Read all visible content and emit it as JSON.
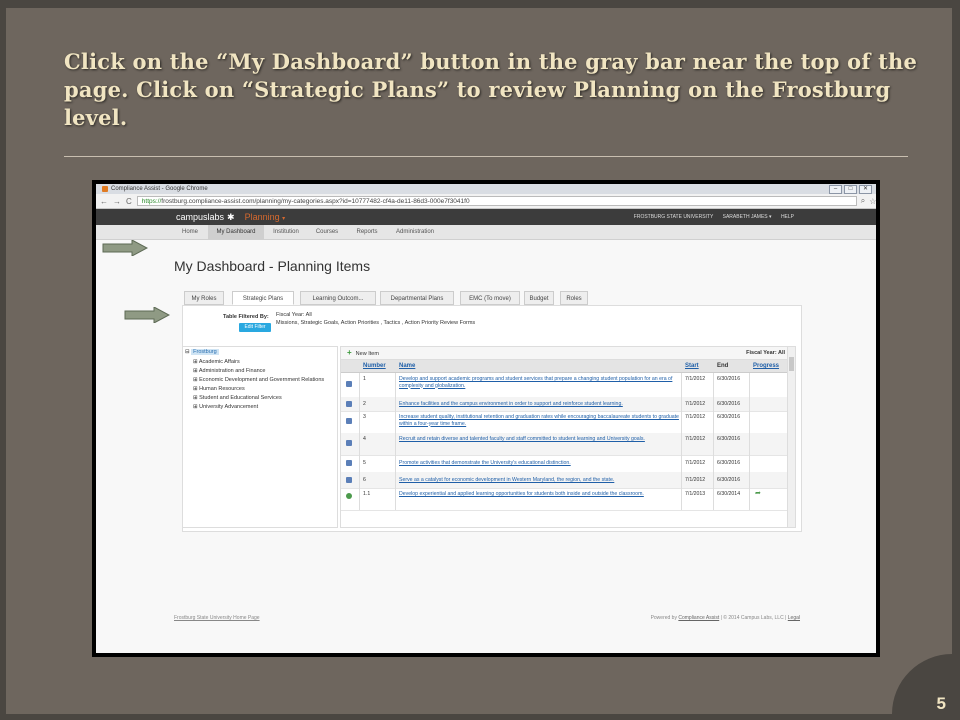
{
  "slide": {
    "title": "Click on the “My Dashboard” button in the gray bar near the top of the page. Click on “Strategic Plans” to review Planning on the Frostburg level.",
    "number": "5"
  },
  "browser": {
    "window_title": "Compliance Assist - Google Chrome",
    "url_scheme": "https://",
    "url_rest": "frostburg.compliance-assist.com/planning/my-categories.aspx?id=10777482-cf4a-de11-86d3-000e7f3041f0"
  },
  "topnav": {
    "logo": "campuslabs",
    "product": "Planning",
    "product_caret": "▾",
    "university": "FROSTBURG STATE UNIVERSITY",
    "user": "SARABETH JAMES ▾",
    "help": "HELP"
  },
  "secnav": [
    "Home",
    "My Dashboard",
    "Institution",
    "Courses",
    "Reports",
    "Administration"
  ],
  "page_title": "My Dashboard - Planning Items",
  "tabs": [
    "My Roles",
    "Strategic Plans",
    "Learning Outcom...",
    "Departmental Plans",
    "EMC (To move)",
    "Budget",
    "Roles"
  ],
  "filter": {
    "label": "Table Filtered By:",
    "line1": "Fiscal Year: All",
    "line2": "Missions, Strategic Goals, Action Priorities , Tactics , Action Priority Review Forms",
    "edit_button": "Edit Filter"
  },
  "tree": {
    "root": "Frostburg",
    "children": [
      "Academic Affairs",
      "Administration and Finance",
      "Economic Development and Government Relations",
      "Human Resources",
      "Student and Educational Services",
      "University Advancement"
    ]
  },
  "grid": {
    "new_item": "New Item",
    "fiscal_year": "Fiscal Year: All",
    "columns": {
      "number": "Number",
      "name": "Name",
      "start": "Start",
      "end": "End",
      "progress": "Progress"
    },
    "rows": [
      {
        "num": "1",
        "name": "Develop and support academic programs and student services that prepare a changing student population for an era of complexity and globalization.",
        "start": "7/1/2012",
        "end": "6/30/2016"
      },
      {
        "num": "2",
        "name": "Enhance facilities and the campus environment in order to support and reinforce student learning.",
        "start": "7/1/2012",
        "end": "6/30/2016"
      },
      {
        "num": "3",
        "name": "Increase student quality, institutional retention and graduation rates while encouraging baccalaureate students to graduate within a four-year time frame.",
        "start": "7/1/2012",
        "end": "6/30/2016"
      },
      {
        "num": "4",
        "name": "Recruit and retain diverse and talented faculty and staff committed to student learning and University goals.",
        "start": "7/1/2012",
        "end": "6/30/2016"
      },
      {
        "num": "5",
        "name": "Promote activities that demonstrate the University's educational distinction.",
        "start": "7/1/2012",
        "end": "6/30/2016"
      },
      {
        "num": "6",
        "name": "Serve as a catalyst for economic development in Western Maryland, the region, and the state.",
        "start": "7/1/2012",
        "end": "6/30/2016"
      },
      {
        "num": "1.1",
        "name": "Develop experiential and applied learning opportunities for students both inside and outside the classroom.",
        "start": "7/1/2013",
        "end": "6/30/2014"
      }
    ]
  },
  "footer": {
    "left": "Frostburg State University Home Page",
    "right_prefix": "Powered by",
    "right_link": "Compliance Assist",
    "right_suffix": "| © 2014 Campus Labs, LLC |",
    "legal": "Legal"
  }
}
